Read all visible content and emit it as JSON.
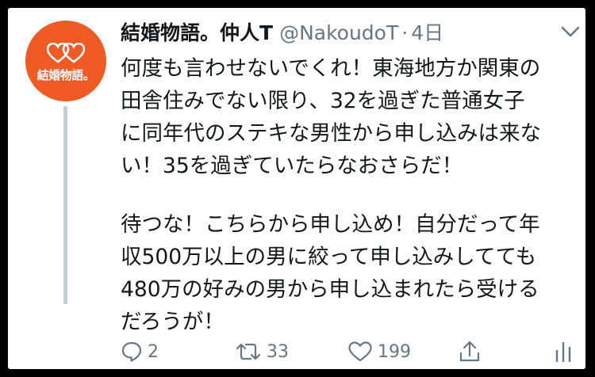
{
  "avatar": {
    "logo_text": "結婚物語。",
    "color": "#f05a23"
  },
  "tweet": {
    "display_name": "結婚物語。仲人T",
    "handle": "@NakoudoT",
    "separator": "·",
    "time": "4日",
    "body_lines": [
      "何度も言わせないでくれ！東海地方か関東の",
      "田舎住みでない限り、32を過ぎた普通女子",
      "に同年代のステキな男性から申し込みは来な",
      "い！35を過ぎていたらなおさらだ！",
      "待つな！こちらから申し込め！自分だって年",
      "収500万以上の男に絞って申し込みしてても",
      "480万の好みの男から申し込まれたら受ける",
      "だろうが！"
    ]
  },
  "actions": {
    "reply": {
      "icon": "reply-icon",
      "count": "2"
    },
    "retweet": {
      "icon": "retweet-icon",
      "count": "33"
    },
    "like": {
      "icon": "heart-icon",
      "count": "199"
    },
    "share": {
      "icon": "share-icon"
    },
    "analytics": {
      "icon": "analytics-icon"
    }
  },
  "colors": {
    "text": "#14171a",
    "secondary": "#657786",
    "thread_line": "#c4cfd6",
    "frame": "#000000"
  }
}
